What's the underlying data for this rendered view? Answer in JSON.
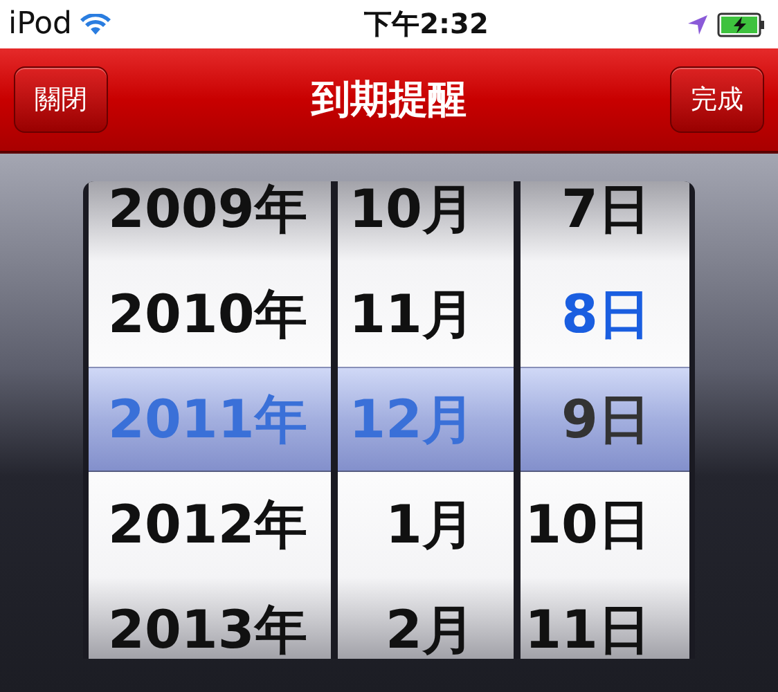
{
  "status_bar": {
    "carrier": "iPod",
    "time": "下午2:32"
  },
  "nav_bar": {
    "left_button": "關閉",
    "title": "到期提醒",
    "right_button": "完成"
  },
  "picker": {
    "columns": [
      {
        "kind": "year",
        "items": [
          {
            "label": "2009年",
            "today": false,
            "selected": false
          },
          {
            "label": "2010年",
            "today": false,
            "selected": false
          },
          {
            "label": "2011年",
            "today": true,
            "selected": true
          },
          {
            "label": "2012年",
            "today": false,
            "selected": false
          },
          {
            "label": "2013年",
            "today": false,
            "selected": false
          }
        ]
      },
      {
        "kind": "month",
        "items": [
          {
            "label": "10月",
            "today": false,
            "selected": false
          },
          {
            "label": "11月",
            "today": false,
            "selected": false
          },
          {
            "label": "12月",
            "today": true,
            "selected": true
          },
          {
            "label": "1月",
            "today": false,
            "selected": false
          },
          {
            "label": "2月",
            "today": false,
            "selected": false
          }
        ]
      },
      {
        "kind": "day",
        "items": [
          {
            "label": "7日",
            "today": false,
            "selected": false
          },
          {
            "label": "8日",
            "today": true,
            "selected": false
          },
          {
            "label": "9日",
            "today": false,
            "selected": true
          },
          {
            "label": "10日",
            "today": false,
            "selected": false
          },
          {
            "label": "11日",
            "today": false,
            "selected": false
          }
        ]
      }
    ]
  }
}
